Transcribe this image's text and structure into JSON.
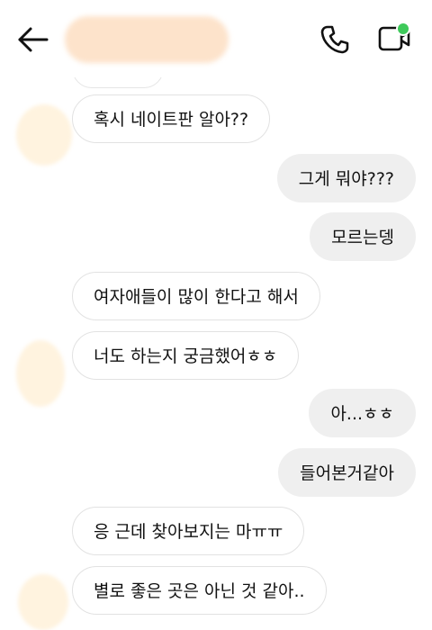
{
  "header": {
    "back_icon": "arrow-left-icon",
    "contact_name_redacted": true,
    "call_icon": "phone-icon",
    "video_icon": "video-camera-icon",
    "online_status_color": "#3ec95a"
  },
  "messages": [
    {
      "side": "in",
      "text": "혹시 네이트판 알아??"
    },
    {
      "side": "out",
      "text": "그게 뭐야???"
    },
    {
      "side": "out",
      "text": "모르는뎅"
    },
    {
      "side": "in",
      "text": "여자애들이 많이 한다고 해서"
    },
    {
      "side": "in",
      "text": "너도 하는지 궁금했어ㅎㅎ"
    },
    {
      "side": "out",
      "text": "아...ㅎㅎ"
    },
    {
      "side": "out",
      "text": "들어본거같아"
    },
    {
      "side": "in",
      "text": "응 근데 찾아보지는 마ㅠㅠ"
    },
    {
      "side": "in",
      "text": "별로 좋은 곳은 아닌 것 같아.."
    }
  ],
  "colors": {
    "incoming_bubble_bg": "#ffffff",
    "incoming_bubble_border": "#e2e2e2",
    "outgoing_bubble_bg": "#efefef",
    "avatar_placeholder": "#fff3df"
  }
}
